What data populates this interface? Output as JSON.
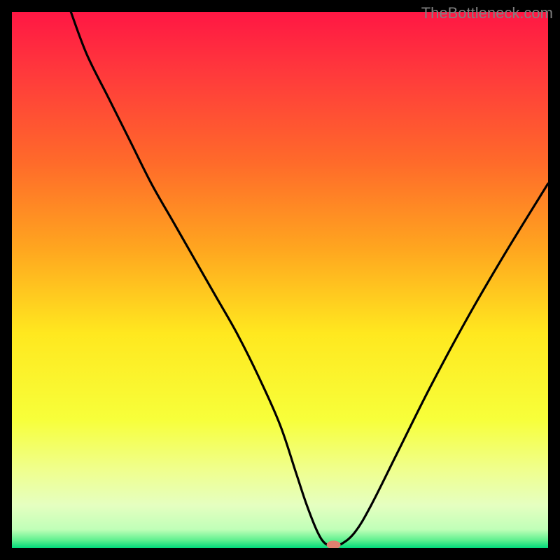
{
  "watermark": "TheBottleneck.com",
  "chart_data": {
    "type": "line",
    "title": "",
    "xlabel": "",
    "ylabel": "",
    "xlim": [
      0,
      100
    ],
    "ylim": [
      0,
      100
    ],
    "grid": false,
    "legend": false,
    "gradient_stops": [
      {
        "offset": 0.0,
        "color": "#ff1744"
      },
      {
        "offset": 0.12,
        "color": "#ff3b3b"
      },
      {
        "offset": 0.28,
        "color": "#ff6a2a"
      },
      {
        "offset": 0.44,
        "color": "#ffa51f"
      },
      {
        "offset": 0.6,
        "color": "#ffe81f"
      },
      {
        "offset": 0.76,
        "color": "#f7ff3a"
      },
      {
        "offset": 0.85,
        "color": "#f0ff8a"
      },
      {
        "offset": 0.92,
        "color": "#e5ffc0"
      },
      {
        "offset": 0.965,
        "color": "#c0ffb8"
      },
      {
        "offset": 0.985,
        "color": "#60f090"
      },
      {
        "offset": 1.0,
        "color": "#00d97a"
      }
    ],
    "series": [
      {
        "name": "bottleneck-curve",
        "color": "#000000",
        "x": [
          11,
          14,
          18,
          22,
          26,
          30,
          34,
          38,
          42,
          46,
          50,
          53,
          55,
          57,
          58.5,
          60,
          61.5,
          64,
          67,
          72,
          78,
          85,
          92,
          100
        ],
        "y": [
          100,
          92,
          84,
          76,
          68,
          61,
          54,
          47,
          40,
          32,
          23,
          14,
          8,
          3,
          0.8,
          0.6,
          0.8,
          3,
          8,
          18,
          30,
          43,
          55,
          68
        ]
      }
    ],
    "marker": {
      "name": "optimal-point",
      "x": 60,
      "y": 0.6,
      "color": "#e08070",
      "rx": 10,
      "ry": 6
    }
  }
}
